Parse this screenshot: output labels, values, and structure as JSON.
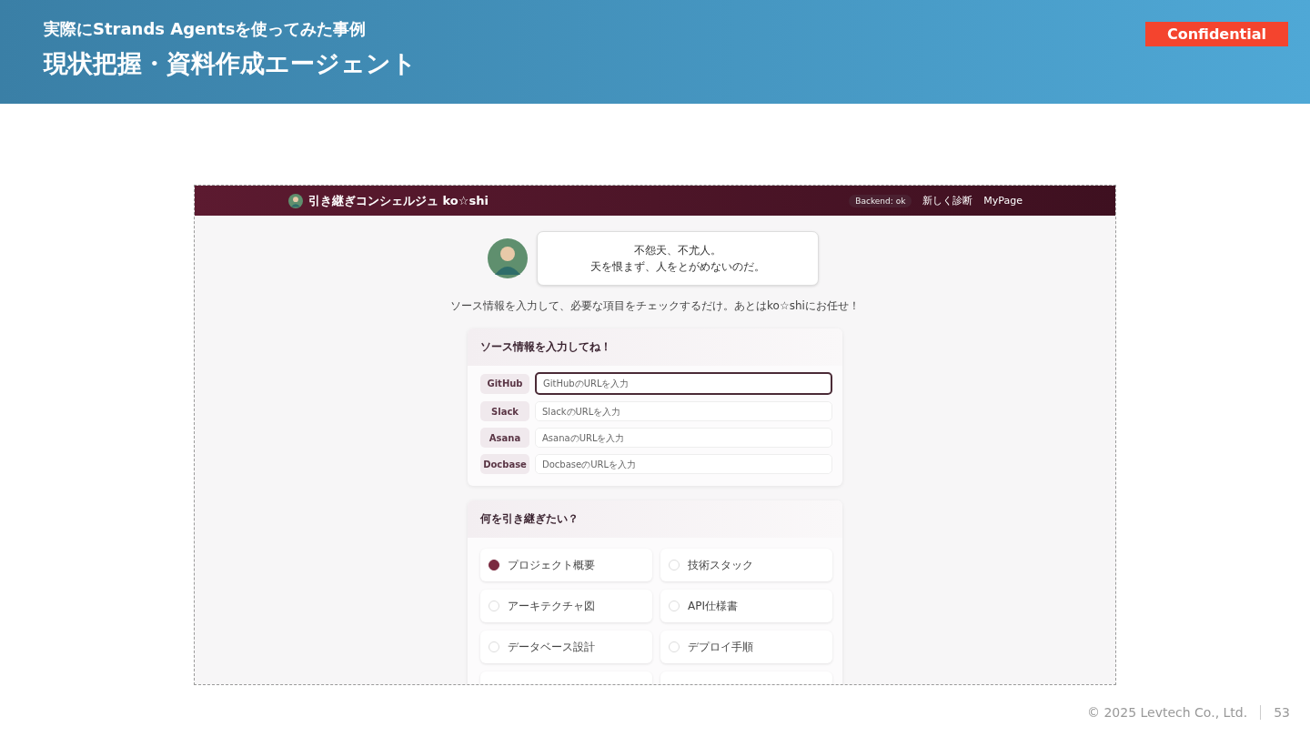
{
  "slide": {
    "subtitle": "実際にStrands Agentsを使ってみた事例",
    "title": "現状把握・資料作成エージェント",
    "badge": "Confidential"
  },
  "app": {
    "brand": "引き継ぎコンシェルジュ ko☆shi",
    "status": "Backend: ok",
    "nav": [
      "新しく診断",
      "MyPage"
    ],
    "speech": [
      "不怨天、不尤人。",
      "天を恨まず、人をとがめないのだ。"
    ],
    "intro": "ソース情報を入力して、必要な項目をチェックするだけ。あとはko☆shiにお任せ！",
    "source_card": {
      "title": "ソース情報を入力してね！",
      "rows": [
        {
          "label": "GitHub",
          "placeholder": "GitHubのURLを入力",
          "focused": true
        },
        {
          "label": "Slack",
          "placeholder": "SlackのURLを入力",
          "focused": false
        },
        {
          "label": "Asana",
          "placeholder": "AsanaのURLを入力",
          "focused": false
        },
        {
          "label": "Docbase",
          "placeholder": "DocbaseのURLを入力",
          "focused": false
        }
      ]
    },
    "topics_card": {
      "title": "何を引き継ぎたい？",
      "options": [
        {
          "label": "プロジェクト概要",
          "checked": true
        },
        {
          "label": "技術スタック",
          "checked": false
        },
        {
          "label": "アーキテクチャ図",
          "checked": false
        },
        {
          "label": "API仕様書",
          "checked": false
        },
        {
          "label": "データベース設計",
          "checked": false
        },
        {
          "label": "デプロイ手順",
          "checked": false
        }
      ]
    }
  },
  "footer": {
    "copyright": "© 2025 Levtech Co., Ltd.",
    "page": "53"
  }
}
